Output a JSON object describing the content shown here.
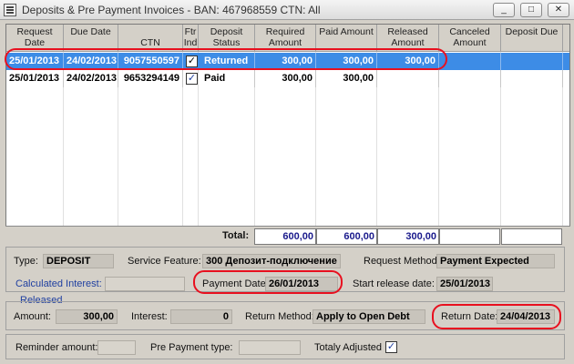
{
  "window": {
    "title": "Deposits & Pre Payment Invoices - BAN: 467968559  CTN: All",
    "minimize": "_",
    "maximize": "□",
    "close": "✕"
  },
  "columns": [
    "Request Date",
    "Due Date",
    "CTN",
    "Ftr Ind",
    "Deposit Status",
    "Required Amount",
    "Paid Amount",
    "Released Amount",
    "Canceled Amount",
    "Deposit Due"
  ],
  "rows": [
    {
      "request_date": "25/01/2013",
      "due_date": "24/02/2013",
      "ctn": "9057550597",
      "ftr_ind": "✓",
      "status": "Returned",
      "required": "300,00",
      "paid": "300,00",
      "released": "300,00",
      "canceled": "",
      "deposit_due": "",
      "selected": true
    },
    {
      "request_date": "25/01/2013",
      "due_date": "24/02/2013",
      "ctn": "9653294149",
      "ftr_ind": "✓",
      "status": "Paid",
      "required": "300,00",
      "paid": "300,00",
      "released": "",
      "canceled": "",
      "deposit_due": "",
      "selected": false
    }
  ],
  "totals": {
    "label": "Total:",
    "required": "600,00",
    "paid": "600,00",
    "released": "300,00",
    "canceled": "",
    "deposit_due": ""
  },
  "details": {
    "type_label": "Type:",
    "type_value": "DEPOSIT",
    "service_feature_label": "Service Feature:",
    "service_feature_value": "300 Депозит-подключение",
    "request_method_label": "Request Method:",
    "request_method_value": "Payment Expected",
    "calculated_interest_label": "Calculated Interest:",
    "calculated_interest_value": "",
    "payment_date_label": "Payment Date:",
    "payment_date_value": "26/01/2013",
    "start_release_label": "Start release date:",
    "start_release_value": "25/01/2013",
    "released_group": "Released",
    "amount_label": "Amount:",
    "amount_value": "300,00",
    "interest_label": "Interest:",
    "interest_value": "0",
    "return_method_label": "Return Method:",
    "return_method_value": "Apply to Open Debt",
    "return_date_label": "Return Date:",
    "return_date_value": "24/04/2013",
    "reminder_label": "Reminder amount:",
    "reminder_value": "",
    "prepayment_type_label": "Pre Payment type:",
    "prepayment_type_value": "",
    "totaly_adjusted_label": "Totaly Adjusted",
    "totaly_adjusted_check": "✓"
  },
  "colors": {
    "selection": "#3d8ce6",
    "highlight_oval": "#e8101f",
    "total_text": "#1a1a8c",
    "label_blue": "#1f3fa0"
  }
}
